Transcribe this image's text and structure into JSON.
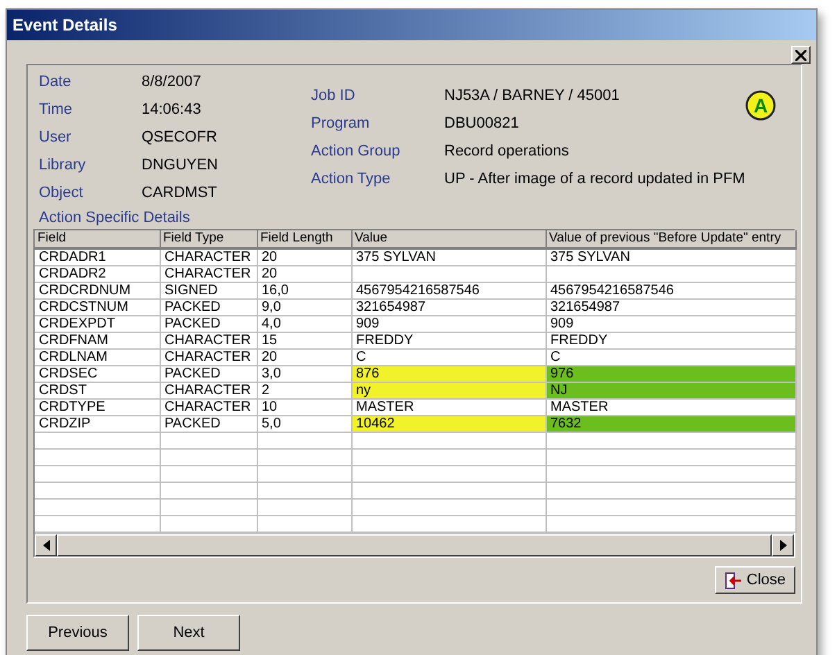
{
  "window": {
    "title": "Event Details"
  },
  "details_left": [
    {
      "label": "Date",
      "value": "8/8/2007"
    },
    {
      "label": "Time",
      "value": "14:06:43"
    },
    {
      "label": "User",
      "value": "QSECOFR"
    },
    {
      "label": "Library",
      "value": "DNGUYEN"
    },
    {
      "label": "Object",
      "value": "CARDMST"
    }
  ],
  "details_right": [
    {
      "label": "Job ID",
      "value": "NJ53A / BARNEY / 45001"
    },
    {
      "label": "Program",
      "value": "DBU00821"
    },
    {
      "label": "Action Group",
      "value": "Record operations"
    },
    {
      "label": "Action Type",
      "value": "UP - After image of a record updated in PFM"
    }
  ],
  "badge": "A",
  "section_label": "Action Specific Details",
  "table": {
    "columns": [
      "Field",
      "Field Type",
      "Field Length",
      "Value",
      "Value of previous \"Before Update\" entry"
    ],
    "rows": [
      {
        "field": "CRDADR1",
        "type": "CHARACTER",
        "length": "20",
        "value": "375 SYLVAN",
        "before": "375 SYLVAN",
        "changed": false
      },
      {
        "field": "CRDADR2",
        "type": "CHARACTER",
        "length": "20",
        "changed": false
      },
      {
        "field": "CRDCRDNUM",
        "type": "SIGNED",
        "length": "16,0",
        "value": "4567954216587546",
        "before": "4567954216587546",
        "changed": false
      },
      {
        "field": "CRDCSTNUM",
        "type": "PACKED",
        "length": "9,0",
        "value": "321654987",
        "before": "321654987",
        "changed": false
      },
      {
        "field": "CRDEXPDT",
        "type": "PACKED",
        "length": "4,0",
        "value": "909",
        "before": "909",
        "changed": false
      },
      {
        "field": "CRDFNAM",
        "type": "CHARACTER",
        "length": "15",
        "value": "FREDDY",
        "before": "FREDDY",
        "changed": false
      },
      {
        "field": "CRDLNAM",
        "type": "CHARACTER",
        "length": "20",
        "value": "C",
        "before": "C",
        "changed": false
      },
      {
        "field": "CRDSEC",
        "type": "PACKED",
        "length": "3,0",
        "value": "876",
        "before": "976",
        "changed": true
      },
      {
        "field": "CRDST",
        "type": "CHARACTER",
        "length": "2",
        "value": "ny",
        "before": "NJ",
        "changed": true
      },
      {
        "field": "CRDTYPE",
        "type": "CHARACTER",
        "length": "10",
        "value": "MASTER",
        "before": "MASTER",
        "changed": false
      },
      {
        "field": "CRDZIP",
        "type": "PACKED",
        "length": "5,0",
        "value": "10462",
        "before": "7632",
        "changed": true
      }
    ]
  },
  "buttons": {
    "close": "Close",
    "previous": "Previous",
    "next": "Next"
  }
}
